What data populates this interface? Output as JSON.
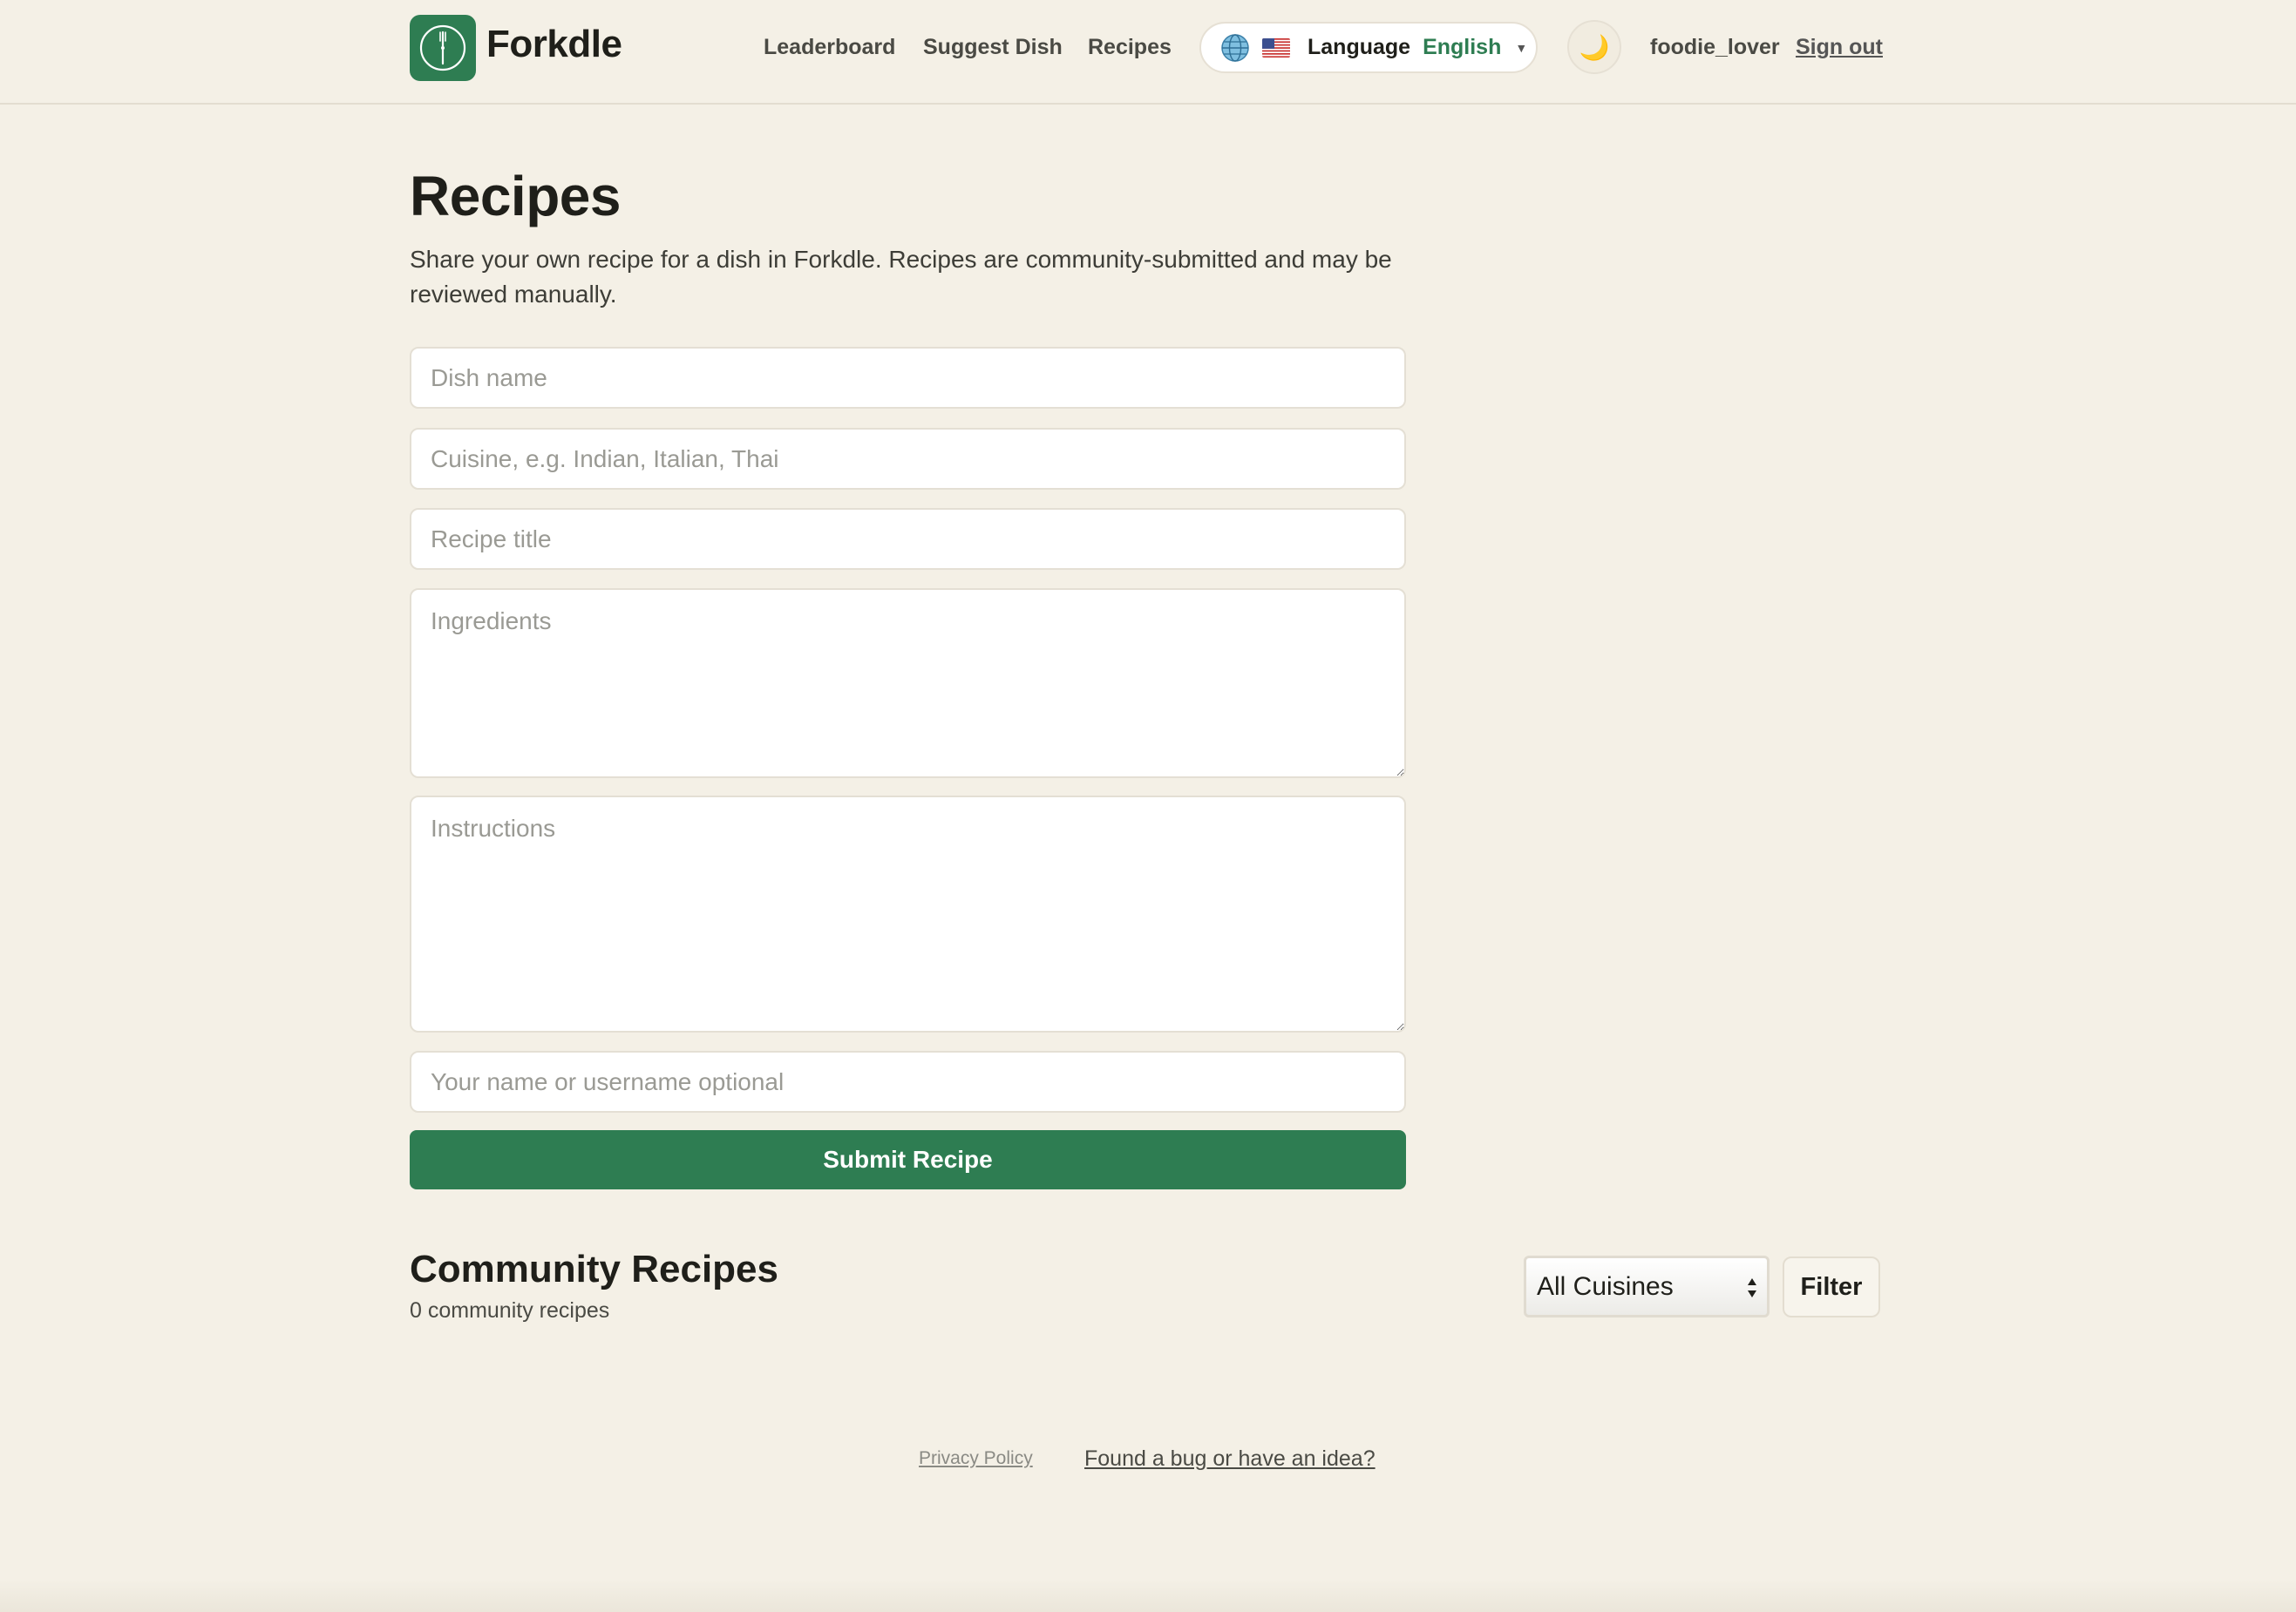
{
  "header": {
    "brand": "Forkdle",
    "nav": {
      "leaderboard": "Leaderboard",
      "suggest_dish": "Suggest Dish",
      "recipes": "Recipes"
    },
    "language": {
      "label": "Language",
      "value": "English",
      "flag_icon": "us-flag-icon",
      "globe_icon": "globe-icon"
    },
    "theme_toggle_icon": "moon-icon",
    "theme_toggle_glyph": "🌙",
    "username": "foodie_lover",
    "sign_out": "Sign out"
  },
  "main": {
    "title": "Recipes",
    "intro": "Share your own recipe for a dish in Forkdle. Recipes are community-submitted and may be reviewed manually.",
    "form": {
      "dish_name_placeholder": "Dish name",
      "cuisine_placeholder": "Cuisine, e.g. Indian, Italian, Thai",
      "recipe_title_placeholder": "Recipe title",
      "ingredients_placeholder": "Ingredients",
      "instructions_placeholder": "Instructions",
      "author_placeholder": "Your name or username optional",
      "submit_label": "Submit Recipe"
    },
    "community": {
      "title": "Community Recipes",
      "count_text": "0 community recipes",
      "filter_select_value": "All Cuisines",
      "filter_button": "Filter"
    }
  },
  "footer": {
    "privacy": "Privacy Policy",
    "feedback": "Found a bug or have an idea?"
  },
  "colors": {
    "accent": "#2e7d52",
    "background": "#f4f0e6"
  }
}
